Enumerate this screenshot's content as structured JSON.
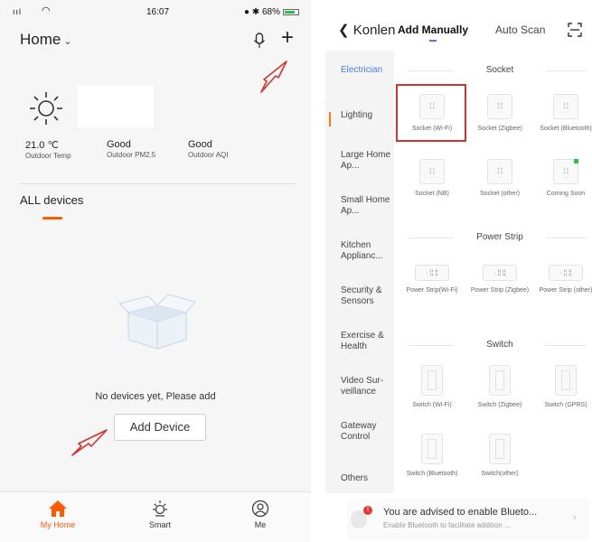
{
  "left": {
    "status": {
      "signal": "ııl",
      "time": "16:07",
      "battery": "68%"
    },
    "header": {
      "title": "Home",
      "chevron": "⌄"
    },
    "weather": {
      "metrics": [
        {
          "value": "21.0 ℃",
          "label": "Outdoor Temp"
        },
        {
          "value": "Good",
          "label": "Outdoor PM2.5"
        },
        {
          "value": "Good",
          "label": "Outdoor AQI"
        }
      ]
    },
    "section_title": "ALL devices",
    "empty_text": "No devices yet, Please add",
    "add_button": "Add Device",
    "tabs": [
      {
        "label": "My Home",
        "icon": "home-icon",
        "active": true
      },
      {
        "label": "Smart",
        "icon": "sun-icon"
      },
      {
        "label": "Me",
        "icon": "profile-icon"
      }
    ],
    "accent": "#ff5a00"
  },
  "right": {
    "header": {
      "back": "Konlen",
      "tab_manual": "Add Manually",
      "tab_auto": "Auto Scan"
    },
    "sidebar": [
      "Electrician",
      "Lighting",
      "Large Home Ap...",
      "Small Home Ap...",
      "Kitchen Applianc...",
      "Security & Sensors",
      "Exercise & Health",
      "Video Sur-veillance",
      "Gateway Control",
      "Others"
    ],
    "sections": {
      "socket": {
        "title": "Socket",
        "items": [
          "Socket (Wi-Fi)",
          "Socket (Zigbee)",
          "Socket (Bluetooth)",
          "Socket (NB)",
          "Socket (other)",
          "Coming Soon"
        ]
      },
      "power_strip": {
        "title": "Power Strip",
        "items": [
          "Power Strip(Wi-Fi)",
          "Power Strip (Zigbee)",
          "Power Strip (other)"
        ]
      },
      "switch": {
        "title": "Switch",
        "items": [
          "Switch (Wi-Fi)",
          "Switch (Zigbee)",
          "Switch (GPRS)",
          "Switch (Bluetooth)",
          "Switch(other)"
        ]
      }
    },
    "notice": {
      "title": "You are advised to enable Blueto...",
      "subtitle": "Enable Bluetooth to facilitate addition ...",
      "badge": "!"
    },
    "accent": "#4a78f0",
    "highlight": "#d3332d"
  }
}
